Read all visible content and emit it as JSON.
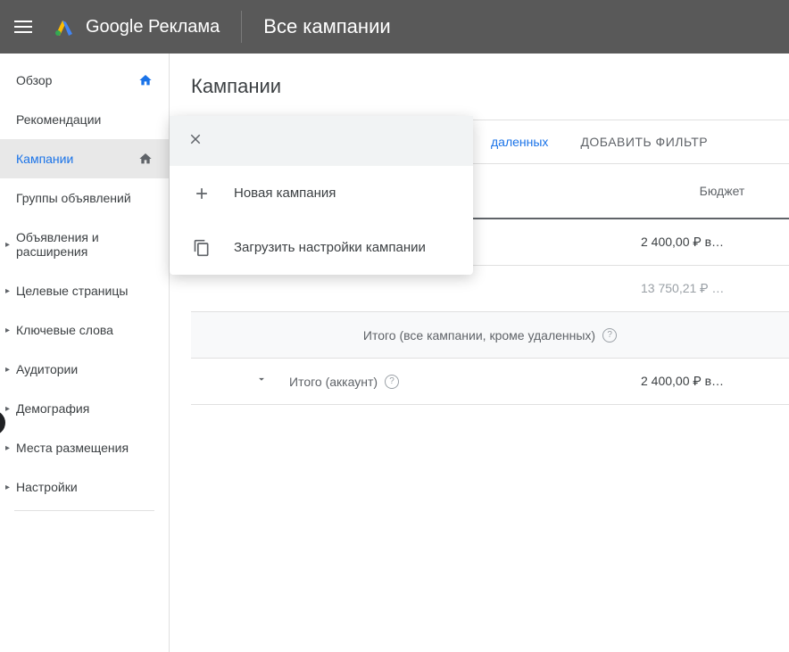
{
  "header": {
    "logo_text": "Google Реклама",
    "title": "Все кампании"
  },
  "sidebar": {
    "items": [
      {
        "label": "Обзор",
        "home": true,
        "arrow": false
      },
      {
        "label": "Рекомендации",
        "home": false,
        "arrow": false
      },
      {
        "label": "Кампании",
        "home": true,
        "arrow": false,
        "active": true
      },
      {
        "label": "Группы объявлений",
        "home": false,
        "arrow": false
      },
      {
        "label": "Объявления и расширения",
        "home": false,
        "arrow": true
      },
      {
        "label": "Целевые страницы",
        "home": false,
        "arrow": true
      },
      {
        "label": "Ключевые слова",
        "home": false,
        "arrow": true
      },
      {
        "label": "Аудитории",
        "home": false,
        "arrow": true
      },
      {
        "label": "Демография",
        "home": false,
        "arrow": true
      },
      {
        "label": "Места размещения",
        "home": false,
        "arrow": true
      },
      {
        "label": "Настройки",
        "home": false,
        "arrow": true
      }
    ]
  },
  "main": {
    "page_title": "Кампании",
    "filter_link_suffix": "даленных",
    "add_filter_label": "ДОБАВИТЬ ФИЛЬТР",
    "budget_header": "Бюджет",
    "rows": [
      {
        "budget": "2 400,00 ₽ в…"
      },
      {
        "budget": "13 750,21 ₽ …"
      }
    ],
    "summary_all": "Итого (все кампании, кроме удаленных)",
    "summary_account": "Итого (аккаунт)",
    "summary_account_budget": "2 400,00 ₽ в…"
  },
  "popup": {
    "new_campaign": "Новая кампания",
    "load_settings": "Загрузить настройки кампании"
  }
}
